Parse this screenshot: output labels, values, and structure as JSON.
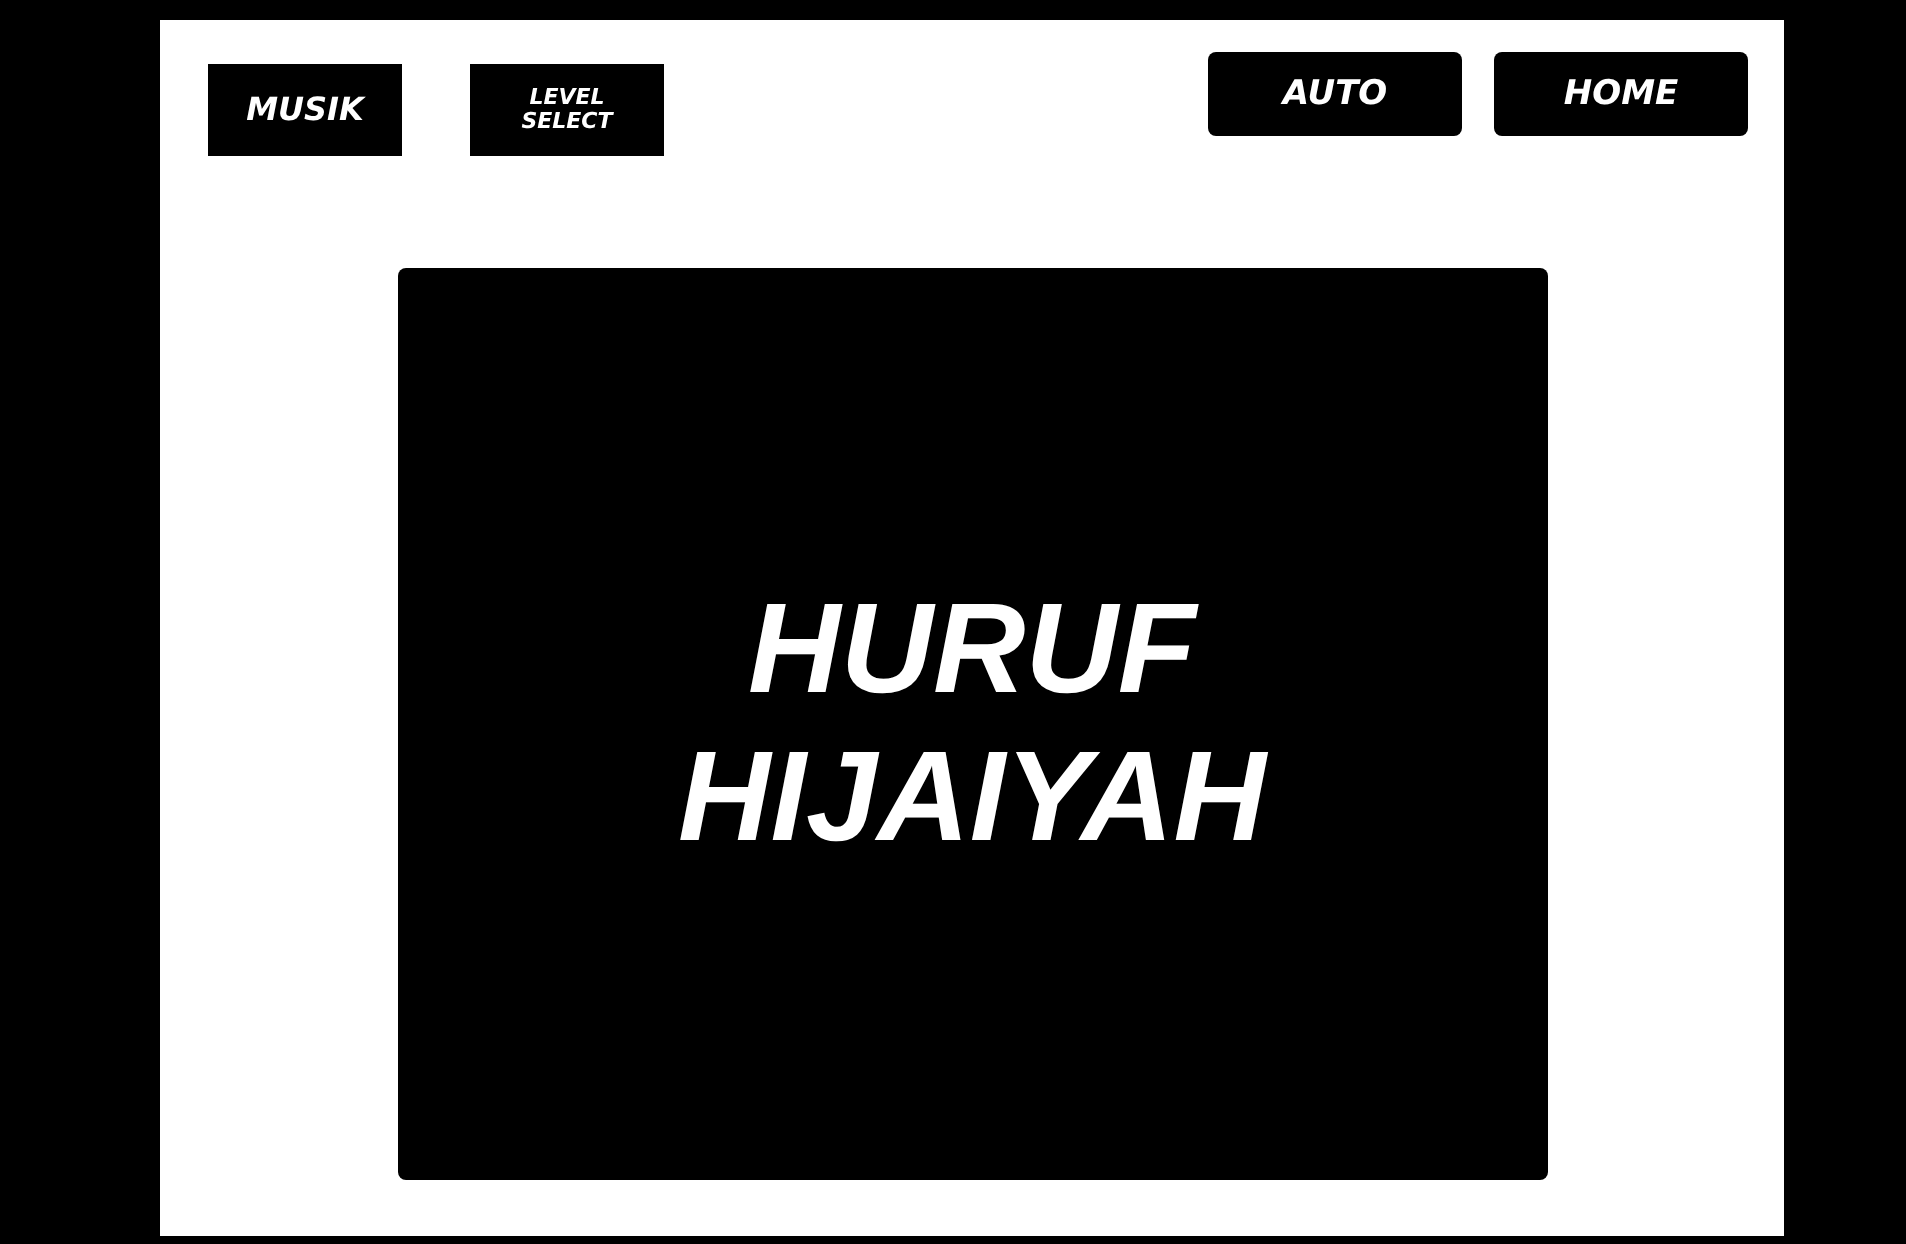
{
  "toolbar": {
    "left_buttons": [
      {
        "label": "MUSIK",
        "kind": "square"
      },
      {
        "label": "LEVEL SELECT",
        "kind": "square-small"
      }
    ],
    "right_buttons": [
      {
        "label": "AUTO",
        "kind": "rounded"
      },
      {
        "label": "HOME",
        "kind": "rounded"
      }
    ]
  },
  "title_panel": {
    "title": "HURUF HIJAIYAH"
  }
}
